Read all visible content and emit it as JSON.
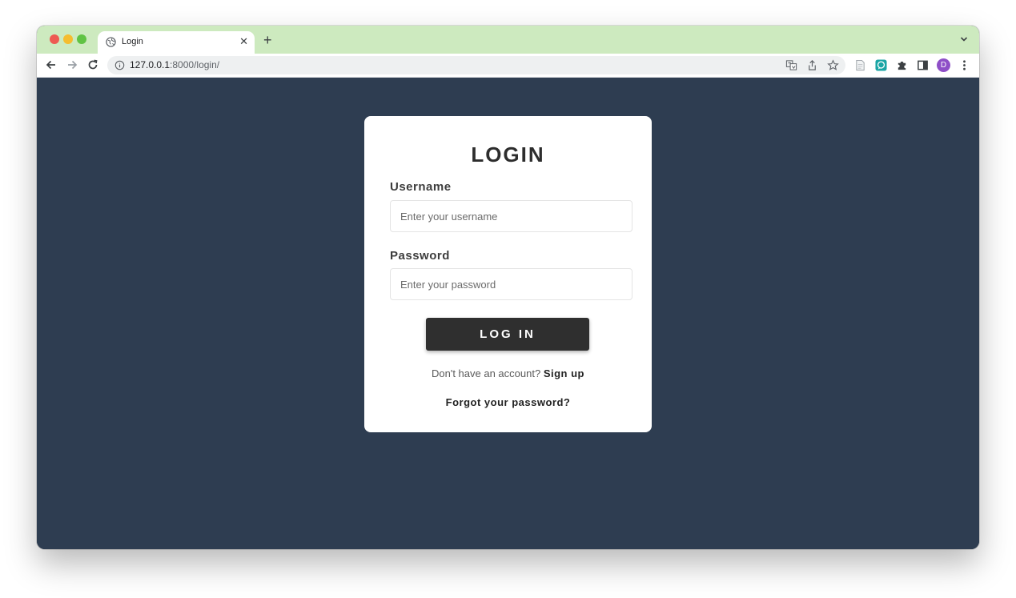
{
  "browser": {
    "tab_title": "Login",
    "tab_close_glyph": "✕",
    "new_tab_glyph": "+",
    "url_host": "127.0.0.1",
    "url_rest": ":8000/login/",
    "avatar_letter": "D",
    "accent_tabstrip": "#cdeabf",
    "avatar_color": "#8e4fc7",
    "icons": [
      "globe-icon",
      "back-arrow-icon",
      "forward-arrow-icon",
      "reload-icon",
      "info-icon",
      "translate-icon",
      "share-icon",
      "bookmark-star-icon",
      "document-extension-icon",
      "chat-extension-icon",
      "puzzle-extensions-icon",
      "side-panel-icon",
      "kebab-menu-icon",
      "chevron-down-icon"
    ]
  },
  "page": {
    "background": "#2e3d51",
    "card_title": "LOGIN",
    "username_label": "Username",
    "username_placeholder": "Enter your username",
    "username_value": "",
    "password_label": "Password",
    "password_placeholder": "Enter your password",
    "password_value": "",
    "login_button": "LOG IN",
    "signup_prompt": "Don't have an account?",
    "signup_link": "Sign up",
    "forgot_link": "Forgot your password?"
  }
}
